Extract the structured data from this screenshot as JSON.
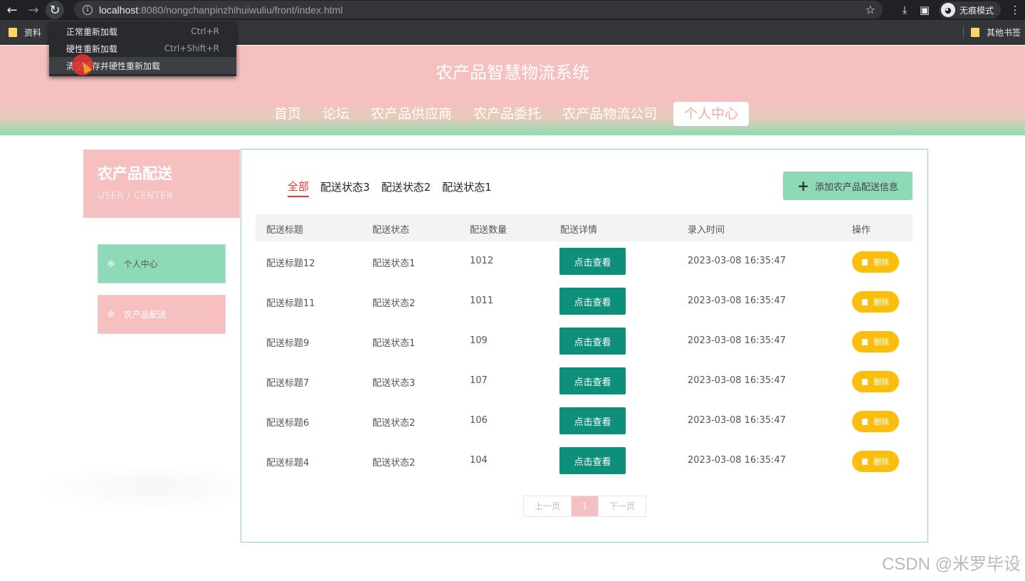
{
  "browser": {
    "url_host": "localhost",
    "url_rest": ":8080/nongchanpinzhihuiwuliu/front/index.html",
    "incognito_label": "无痕模式",
    "bookmark_left": "资料",
    "bookmark_right": "其他书签"
  },
  "context_menu": {
    "items": [
      {
        "label": "正常重新加载",
        "shortcut": "Ctrl+R"
      },
      {
        "label": "硬性重新加载",
        "shortcut": "Ctrl+Shift+R"
      },
      {
        "label": "清空缓存并硬性重新加载",
        "shortcut": ""
      }
    ]
  },
  "site": {
    "title": "农产品智慧物流系统",
    "nav": [
      "首页",
      "论坛",
      "农产品供应商",
      "农产品委托",
      "农产品物流公司",
      "个人中心"
    ]
  },
  "sidebar": {
    "title": "农产品配送",
    "subtitle": "USER / CENTER",
    "items": [
      "个人中心",
      "农产品配送"
    ]
  },
  "main": {
    "tabs": [
      "全部",
      "配送状态3",
      "配送状态2",
      "配送状态1"
    ],
    "add_button": "添加农产品配送信息",
    "columns": [
      "配送标题",
      "配送状态",
      "配送数量",
      "配送详情",
      "录入时间",
      "操作"
    ],
    "view_label": "点击查看",
    "delete_label": "删除",
    "rows": [
      {
        "title": "配送标题12",
        "status": "配送状态1",
        "qty": "1012",
        "time": "2023-03-08 16:35:47"
      },
      {
        "title": "配送标题11",
        "status": "配送状态2",
        "qty": "1011",
        "time": "2023-03-08 16:35:47"
      },
      {
        "title": "配送标题9",
        "status": "配送状态1",
        "qty": "109",
        "time": "2023-03-08 16:35:47"
      },
      {
        "title": "配送标题7",
        "status": "配送状态3",
        "qty": "107",
        "time": "2023-03-08 16:35:47"
      },
      {
        "title": "配送标题6",
        "status": "配送状态2",
        "qty": "106",
        "time": "2023-03-08 16:35:47"
      },
      {
        "title": "配送标题4",
        "status": "配送状态2",
        "qty": "104",
        "time": "2023-03-08 16:35:47"
      }
    ],
    "pager": {
      "prev": "上一页",
      "current": "1",
      "next": "下一页"
    }
  },
  "watermark": "CSDN @米罗毕设",
  "colors": {
    "pink": "#f7c0c0",
    "green": "#8ed9b8",
    "teal": "#0d8f79",
    "yellow": "#fbbe0c",
    "red": "#e53935"
  }
}
